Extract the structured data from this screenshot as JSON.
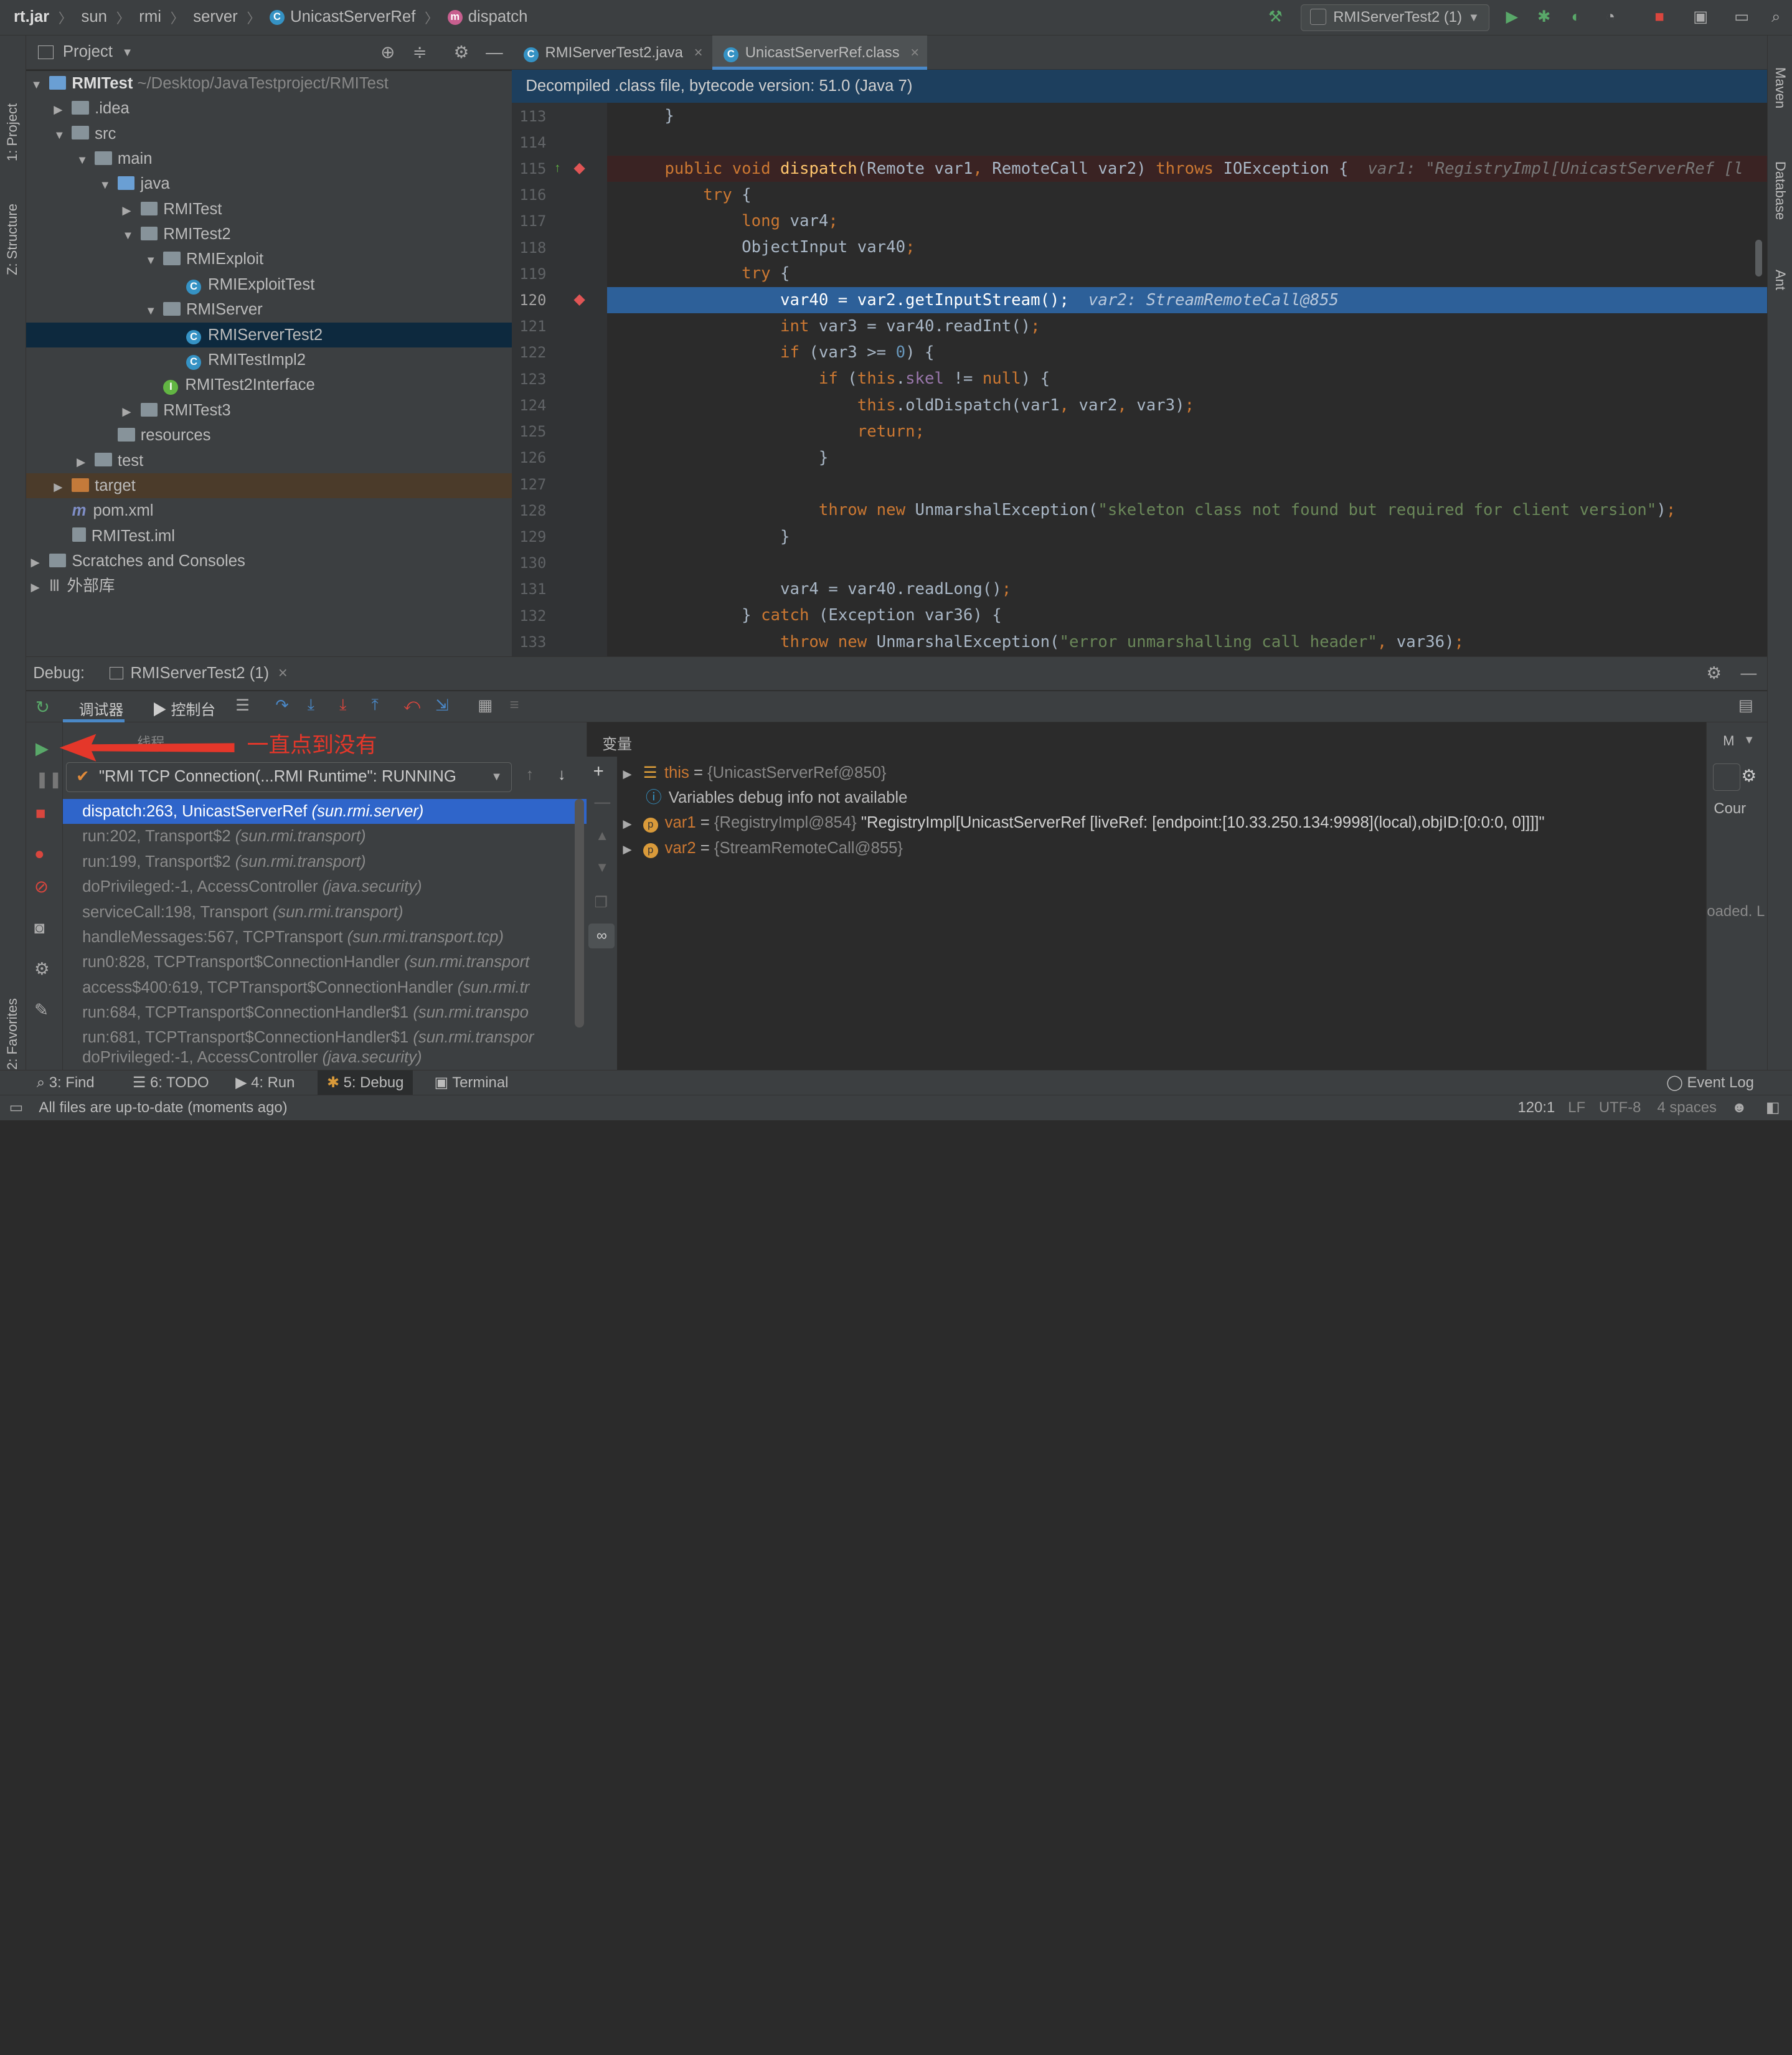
{
  "breadcrumb": [
    "rt.jar",
    "sun",
    "rmi",
    "server",
    "UnicastServerRef",
    "dispatch"
  ],
  "run_config": "RMIServerTest2 (1)",
  "left_strip": {
    "project": "1: Project",
    "structure": "Z: Structure",
    "favorites": "2: Favorites"
  },
  "right_strip": {
    "maven": "Maven",
    "database": "Database",
    "ant": "Ant"
  },
  "project_panel": {
    "title": "Project"
  },
  "tree": [
    {
      "label": "RMITest",
      "extra": "~/Desktop/JavaTestproject/RMITest"
    },
    {
      "label": ".idea"
    },
    {
      "label": "src"
    },
    {
      "label": "main"
    },
    {
      "label": "java"
    },
    {
      "label": "RMITest"
    },
    {
      "label": "RMITest2"
    },
    {
      "label": "RMIExploit"
    },
    {
      "label": "RMIExploitTest"
    },
    {
      "label": "RMIServer"
    },
    {
      "label": "RMIServerTest2"
    },
    {
      "label": "RMITestImpl2"
    },
    {
      "label": "RMITest2Interface"
    },
    {
      "label": "RMITest3"
    },
    {
      "label": "resources"
    },
    {
      "label": "test"
    },
    {
      "label": "target"
    },
    {
      "label": "pom.xml"
    },
    {
      "label": "RMITest.iml"
    },
    {
      "label": "Scratches and Consoles"
    },
    {
      "label": "外部库"
    }
  ],
  "editor": {
    "tabs": [
      "RMIServerTest2.java",
      "UnicastServerRef.class"
    ],
    "info": "Decompiled .class file, bytecode version: 51.0 (Java 7)",
    "line_numbers": [
      "113",
      "114",
      "115",
      "116",
      "117",
      "118",
      "119",
      "120",
      "121",
      "122",
      "123",
      "124",
      "125",
      "126",
      "127",
      "128",
      "129",
      "130",
      "131",
      "132",
      "133"
    ],
    "inline_hint_115": "var1: \"RegistryImpl[UnicastServerRef [l",
    "inline_hint_120": "var2: StreamRemoteCall@855"
  },
  "debug": {
    "label": "Debug:",
    "session_tab": "RMIServerTest2 (1)",
    "tab_debugger": "调试器",
    "tab_console": "控制台",
    "threads_label": "线程",
    "annotation": "一直点到没有",
    "thread_select": "\"RMI TCP Connection(...RMI Runtime\": RUNNING",
    "variables_label": "变量",
    "frames": [
      {
        "method": "dispatch:263, UnicastServerRef",
        "pkg": "(sun.rmi.server)"
      },
      {
        "method": "run:202, Transport$2",
        "pkg": "(sun.rmi.transport)"
      },
      {
        "method": "run:199, Transport$2",
        "pkg": "(sun.rmi.transport)"
      },
      {
        "method": "doPrivileged:-1, AccessController",
        "pkg": "(java.security)"
      },
      {
        "method": "serviceCall:198, Transport",
        "pkg": "(sun.rmi.transport)"
      },
      {
        "method": "handleMessages:567, TCPTransport",
        "pkg": "(sun.rmi.transport.tcp)"
      },
      {
        "method": "run0:828, TCPTransport$ConnectionHandler",
        "pkg": "(sun.rmi.transport"
      },
      {
        "method": "access$400:619, TCPTransport$ConnectionHandler",
        "pkg": "(sun.rmi.tr"
      },
      {
        "method": "run:684, TCPTransport$ConnectionHandler$1",
        "pkg": "(sun.rmi.transpo"
      },
      {
        "method": "run:681, TCPTransport$ConnectionHandler$1",
        "pkg": "(sun.rmi.transpor"
      },
      {
        "method": "doPrivileged:-1, AccessController",
        "pkg": "(java.security)"
      }
    ],
    "vars": {
      "this_name": "this",
      "this_val": "{UnicastServerRef@850}",
      "info": "Variables debug info not available",
      "var1_name": "var1",
      "var1_ref": "{RegistryImpl@854}",
      "var1_str": "\"RegistryImpl[UnicastServerRef [liveRef: [endpoint:[10.33.250.134:9998](local),objID:[0:0:0, 0]]]]\"",
      "var2_name": "var2",
      "var2_val": "{StreamRemoteCall@855}"
    },
    "watch": {
      "m": "M",
      "cour": "Cour",
      "loaded": "oaded. L"
    }
  },
  "tool_tabs": [
    "3: Find",
    "6: TODO",
    "4: Run",
    "5: Debug",
    "Terminal"
  ],
  "event_log": "Event Log",
  "status": {
    "message": "All files are up-to-date (moments ago)",
    "position": "120:1",
    "lf": "LF",
    "encoding": "UTF-8",
    "indent": "4 spaces"
  }
}
